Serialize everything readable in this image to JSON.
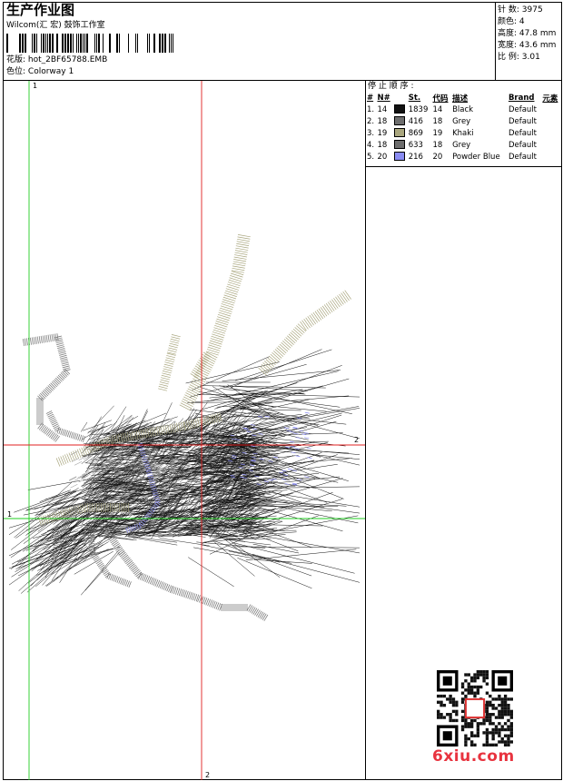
{
  "header": {
    "title": "生产作业图",
    "subtitle": "Wilcom(汇 宏) 鼓饰工作室",
    "design_label": "花版:",
    "design_file": "hot_2BF65788.EMB",
    "colorway_label": "色位:",
    "colorway": "Colorway 1"
  },
  "stats": [
    {
      "label": "针 数:",
      "value": "3975"
    },
    {
      "label": "颜色:",
      "value": "4"
    },
    {
      "label": "高度:",
      "value": "47.8 mm"
    },
    {
      "label": "宽度:",
      "value": "43.6 mm"
    },
    {
      "label": "比 例:",
      "value": "3.01"
    }
  ],
  "stop_sequence": {
    "title": "停 止 顺 序 :",
    "columns": [
      "#",
      "N#",
      "St.",
      "代码",
      "描述",
      "Brand",
      "元素"
    ],
    "rows": [
      {
        "idx": "1.",
        "n": "14",
        "swatch": "#111111",
        "st": "1839",
        "code": "14",
        "desc": "Black",
        "brand": "Default"
      },
      {
        "idx": "2.",
        "n": "18",
        "swatch": "#6e6e6e",
        "st": "416",
        "code": "18",
        "desc": "Grey",
        "brand": "Default"
      },
      {
        "idx": "3.",
        "n": "19",
        "swatch": "#a9a67e",
        "st": "869",
        "code": "19",
        "desc": "Khaki",
        "brand": "Default"
      },
      {
        "idx": "4.",
        "n": "18",
        "swatch": "#6e6e6e",
        "st": "633",
        "code": "18",
        "desc": "Grey",
        "brand": "Default"
      },
      {
        "idx": "5.",
        "n": "20",
        "swatch": "#8a8cf2",
        "st": "216",
        "code": "20",
        "desc": "Powder Blue",
        "brand": "Default"
      }
    ]
  },
  "guides": {
    "green_v": "1",
    "green_h": "1",
    "red_h": "2",
    "red_v": "2",
    "green_color": "#22cc22",
    "red_color": "#e02020"
  },
  "watermark": "6xiu.com"
}
